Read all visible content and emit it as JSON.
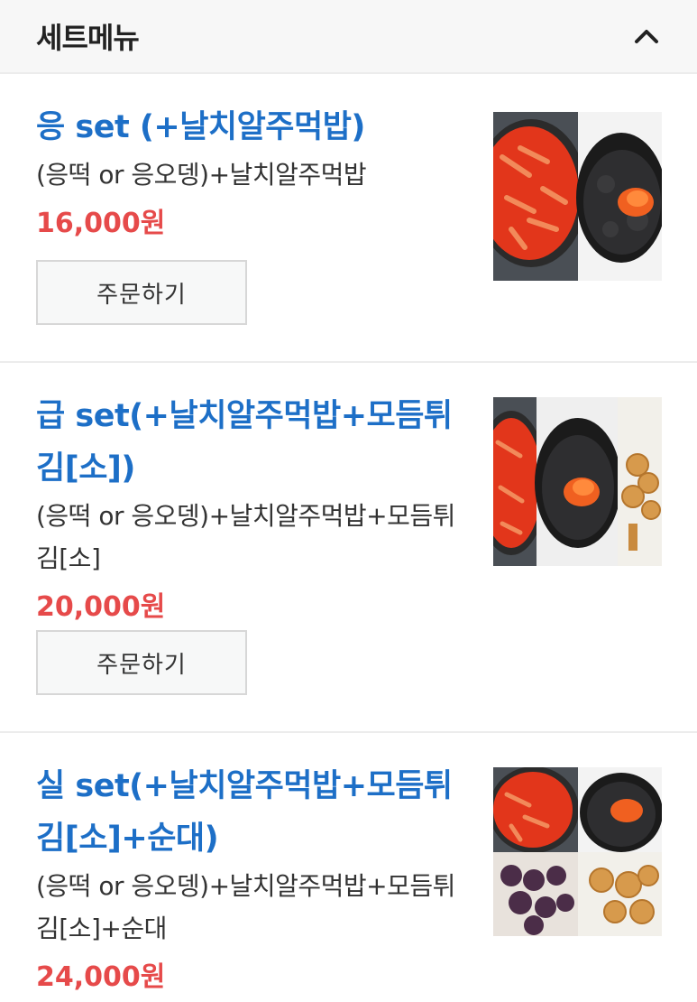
{
  "header": {
    "title": "세트메뉴"
  },
  "items": [
    {
      "name": "응 set (+날치알주먹밥)",
      "desc": "(응떡 or 응오뎅)+날치알주먹밥",
      "price": "16,000원",
      "button": "주문하기"
    },
    {
      "name": "급 set(+날치알주먹밥+모듬튀김[소])",
      "desc": "(응떡 or 응오뎅)+날치알주먹밥+모듬튀김[소]",
      "price": "20,000원",
      "button": "주문하기"
    },
    {
      "name": "실 set(+날치알주먹밥+모듬튀김[소]+순대)",
      "desc": "(응떡 or 응오뎅)+날치알주먹밥+모듬튀김[소]+순대",
      "price": "24,000원"
    }
  ],
  "icons": {
    "collapse": "chevron-up-icon"
  },
  "colors": {
    "name": "#1d6fc7",
    "price": "#e64a4a"
  }
}
